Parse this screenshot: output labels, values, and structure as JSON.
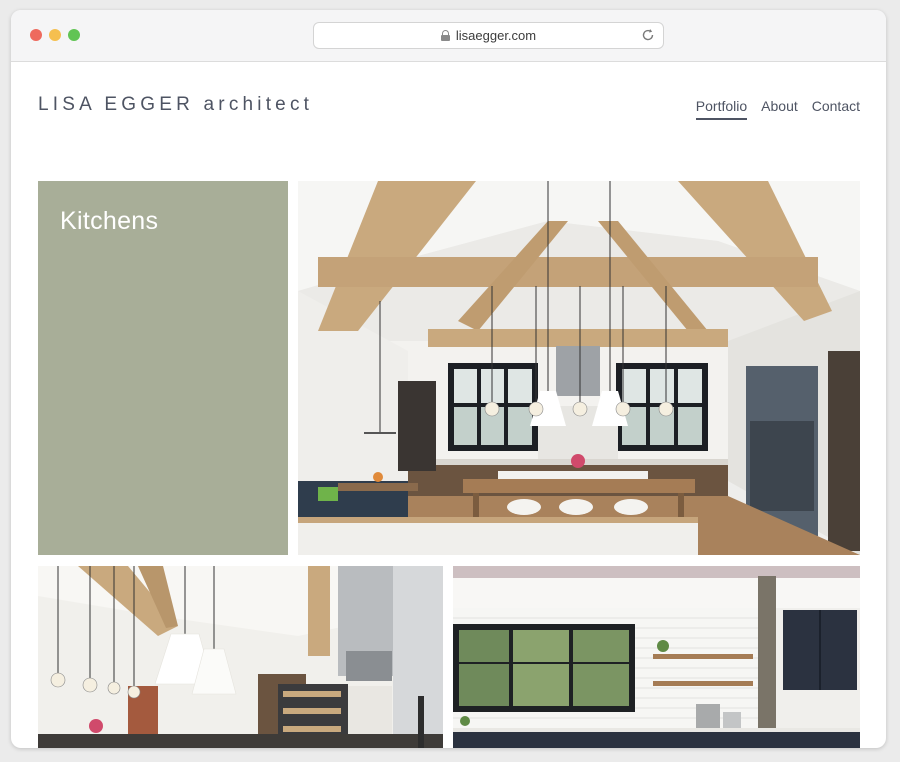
{
  "browser": {
    "url": "lisaegger.com"
  },
  "site": {
    "logo": "LISA EGGER architect",
    "nav": [
      {
        "label": "Portfolio",
        "active": true
      },
      {
        "label": "About",
        "active": false
      },
      {
        "label": "Contact",
        "active": false
      }
    ]
  },
  "gallery": {
    "category_title": "Kitchens",
    "tile_color": "#a8ae98"
  },
  "colors": {
    "text": "#4e5463",
    "wood": "#c9a97e"
  }
}
